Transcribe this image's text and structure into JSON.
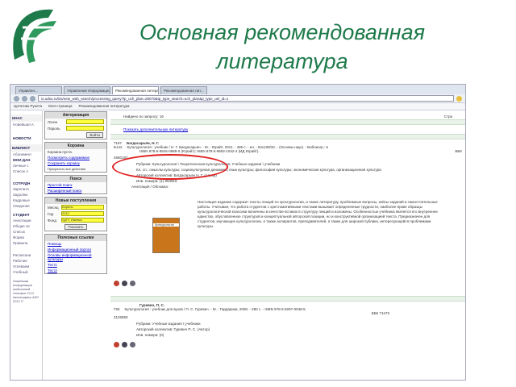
{
  "slide": {
    "title_line1": "Основная рекомендованная",
    "title_line2": "литература",
    "accent_color": "#1e7a4a"
  },
  "browser": {
    "tabs": [
      "Управлен...",
      "Управление Информацио...",
      "Рекомендованная литерату...",
      "Рекомендованная лит..."
    ],
    "url": "io.udsu.ru/iss/new_web_search/processing_query?lp_uch_plan=28070&tp_type_search=uch_plan&p_type_uel_id=1",
    "bookmarks": [
      "Цитатник Рунета",
      "Моя страница",
      "Рекомендованная литература"
    ]
  },
  "left_nav": {
    "header1": "ИНАС",
    "items1": [
      "Новейшая А",
      "НОВОСТИ"
    ],
    "header2": "БИБЛИОТ",
    "items2": [
      "Абонемент",
      "МОИ ДАН",
      "Личные с",
      "Список л",
      "СОТРУДН",
      "Зарплата",
      "Задолжн",
      "Кадровые",
      "Сведения",
      "СТУДЕНТ",
      "Аннотации",
      "Общие св",
      "Список",
      "Форма",
      "Правила",
      "Расписани",
      "Рабочие",
      "Успеваем",
      "Учебный"
    ],
    "footer": "Новейшая информация мобильный телефон ССО мессенджер АИС 2012 ©"
  },
  "sidebar": {
    "auth": {
      "title": "Авторизация",
      "login_label": "Логин",
      "password_label": "Пароль",
      "submit": "Войти"
    },
    "cart": {
      "title": "Корзина",
      "empty": "Корзина пуста.",
      "link1": "Посмотреть содержимое",
      "link2": "Сохранить корзину",
      "note": "Прекратить все действия"
    },
    "search": {
      "title": "Поиск",
      "simple": "Простой поиск",
      "advanced": "Расширенный поиск"
    },
    "new_arrivals": {
      "title": "Новые поступления",
      "month_label": "Месяц",
      "month_value": "Апрель",
      "year_label": "Год",
      "year_value": "2012",
      "fund_label": "Фонд",
      "fund_value": "УдГУ, Ижевск",
      "button": "Показать"
    },
    "useful_links": {
      "title": "Полезные ссылки",
      "items": [
        "Помощь",
        "Информационный портал",
        "Основы информационной культуры",
        "Тест1",
        "Тест2"
      ]
    }
  },
  "main": {
    "found_label": "Найдено по запросу: 16",
    "show_more": "Показать дополнительную литературу",
    "page_label": "Стра",
    "records": [
      {
        "num": "7197",
        "code": "Б142",
        "author": "Багдасарьян, Н. Г.",
        "desc": "Культурология : учебник / Н. Г. Багдасарьян. - М. : Юрайт, 2011. - 495 с. : ил. ; 84x108/32. - (Основы наук). - Библиогр.: в",
        "isbn": "ISBN 978-5-9916-0989-0 (Юрайт); ISBN 978-5-9692-1042-4 (ИД Юрайт).",
        "bbk": "ББК",
        "id": "4660187",
        "rubrics": "Рубрики: Культурология \\ Теоретическая культурология; Учебные издания \\ учебники",
        "keywords": "Кл. сл.: смыслы культуры; социокультурная динамика; язык культуры; философия культуры; экономическая культура, организационная культура",
        "collective": "Авторский коллектив: Багдасарьян Н. Г. (Автор)",
        "inventory": "Инв. номера: (1) 994816",
        "annotation_label": "Аннотация / Обложка:",
        "annotation": "Настоящее издание содержит тексты лекций по культурологии, а также литературу, проблемные вопросы, кейсы заданий и самостоятельные работы. Учитывая, что работа студентов с хрестоматийными текстами вызывает определенные трудности, наиболее яркие образцы культурологической классики включены в качестве вставок в структуру лекций и изложены. Особенностью учебника является его внутреннее единство, обусловленное структурой и концептуальной авторской позиции, но и конструктивной организацией текста. Предназначен для студентов, изучающих культурологию, а также аспирантов, преподавателей, а также для широкой публики, интересующейся проблемами культуры.",
        "cover_title": "Культурология"
      },
      {
        "num": "Г95",
        "author": "Гуревич, П. С.",
        "desc": "Культурология : учебник для вузов / П. С. Гуревич. - М. : Гардарики, 2008. - 280 с. - ISBN 978-5-8297-0048-5.",
        "bbk": "ББК 71я73",
        "id": "2126850",
        "rubrics": "Рубрики: Учебные издания \\ учебники",
        "collective": "Авторский коллектив: Гуревич П. С. (Автор)",
        "inventory": "Инв. номера: (0)"
      }
    ]
  }
}
